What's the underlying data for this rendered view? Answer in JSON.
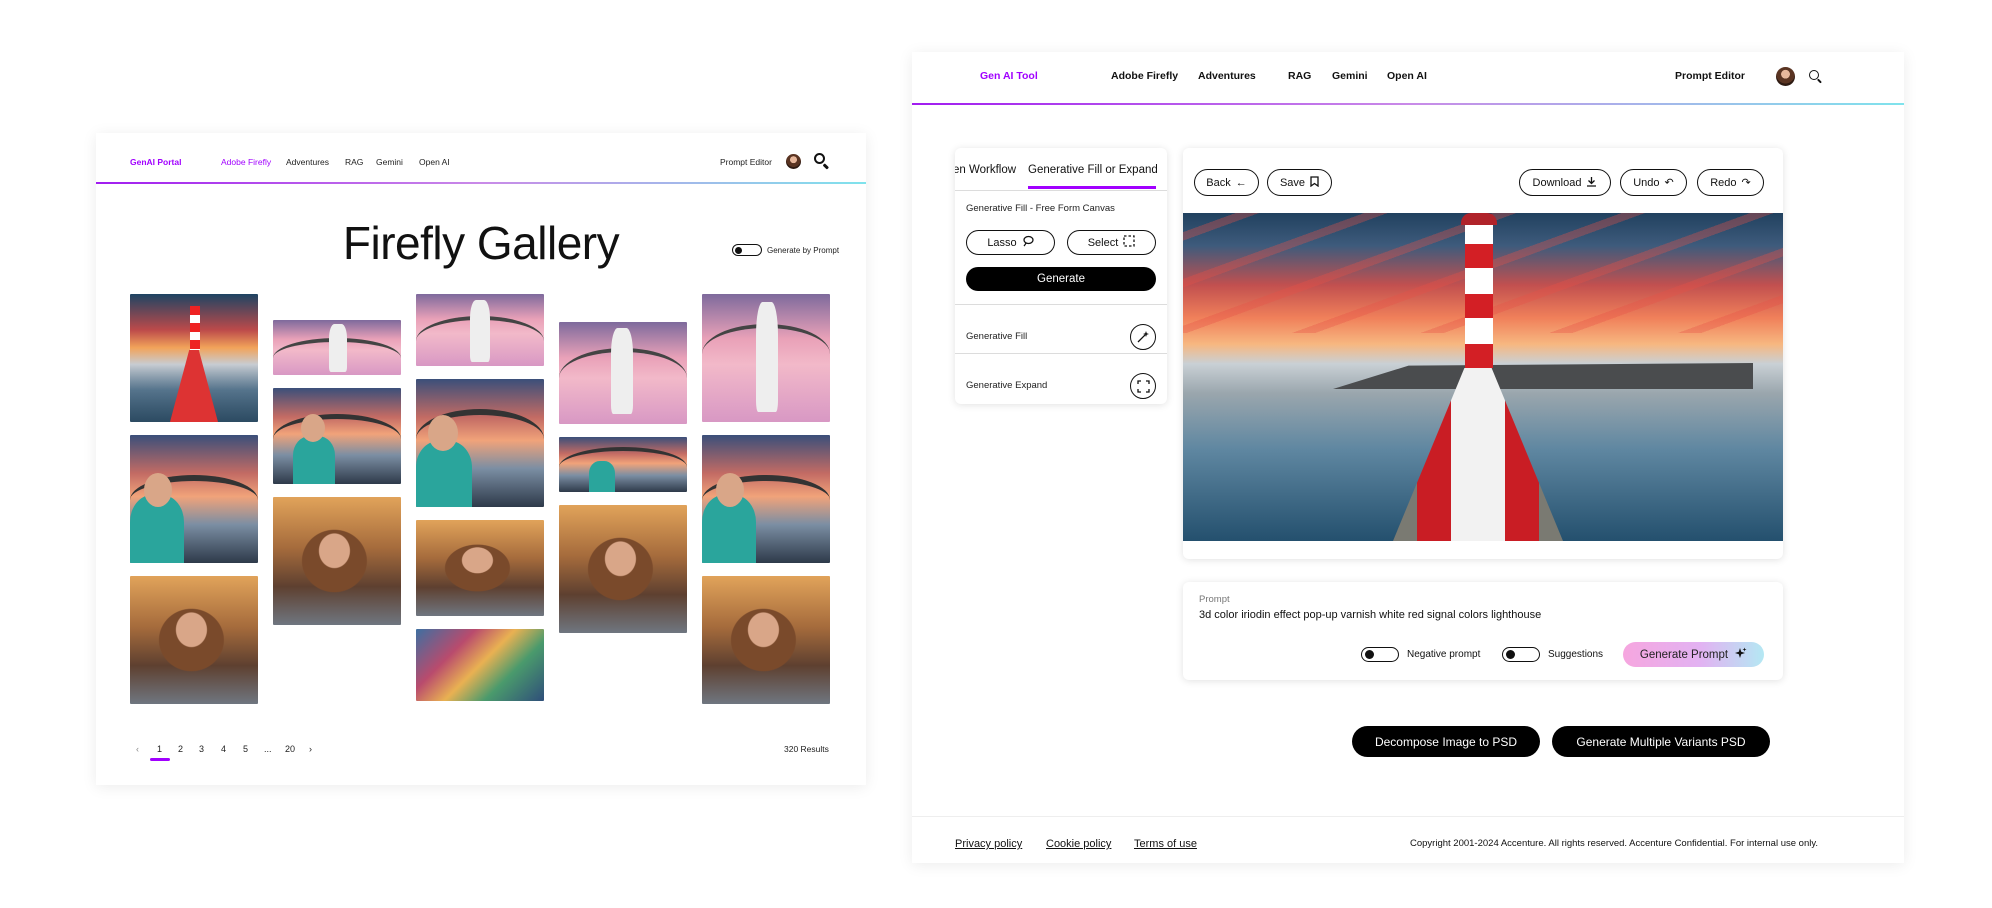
{
  "gallery": {
    "nav": {
      "brand": "GenAI Portal",
      "links": [
        "Adobe Firefly",
        "Adventures",
        "RAG",
        "Gemini",
        "Open AI"
      ],
      "prompt_editor": "Prompt Editor"
    },
    "title": "Firefly Gallery",
    "toggle_label": "Generate by Prompt",
    "pagination": {
      "prev": "‹",
      "pages": [
        "1",
        "2",
        "3",
        "4",
        "5",
        "...",
        "20"
      ],
      "next": "›",
      "results": "320 Results"
    }
  },
  "tool": {
    "nav": {
      "brand": "Gen AI Tool",
      "links": [
        "Adobe Firefly",
        "Adventures",
        "RAG",
        "Gemini",
        "Open AI"
      ],
      "prompt_editor": "Prompt Editor"
    },
    "side": {
      "tabs": [
        "en Workflow",
        "Generative Fill or Expand"
      ],
      "section_title": "Generative Fill - Free Form Canvas",
      "lasso": "Lasso",
      "select": "Select",
      "generate": "Generate",
      "gen_fill": "Generative Fill",
      "gen_expand": "Generative Expand"
    },
    "toolbar": {
      "back": "Back",
      "save": "Save",
      "download": "Download",
      "undo": "Undo",
      "redo": "Redo"
    },
    "prompt": {
      "label": "Prompt",
      "text": "3d color iriodin effect pop-up varnish white red signal colors lighthouse",
      "negative": "Negative prompt",
      "suggestions": "Suggestions",
      "generate_prompt": "Generate Prompt"
    },
    "actions": {
      "decompose": "Decompose Image to PSD",
      "variants": "Generate Multiple Variants PSD"
    },
    "footer": {
      "privacy": "Privacy policy",
      "cookie": "Cookie policy",
      "terms": "Terms of use",
      "copyright": "Copyright 2001-2024 Accenture. All rights reserved. Accenture Confidential. For internal use only."
    }
  },
  "colors": {
    "accent": "#a100ff",
    "gradient_end": "#7fe3ec"
  }
}
